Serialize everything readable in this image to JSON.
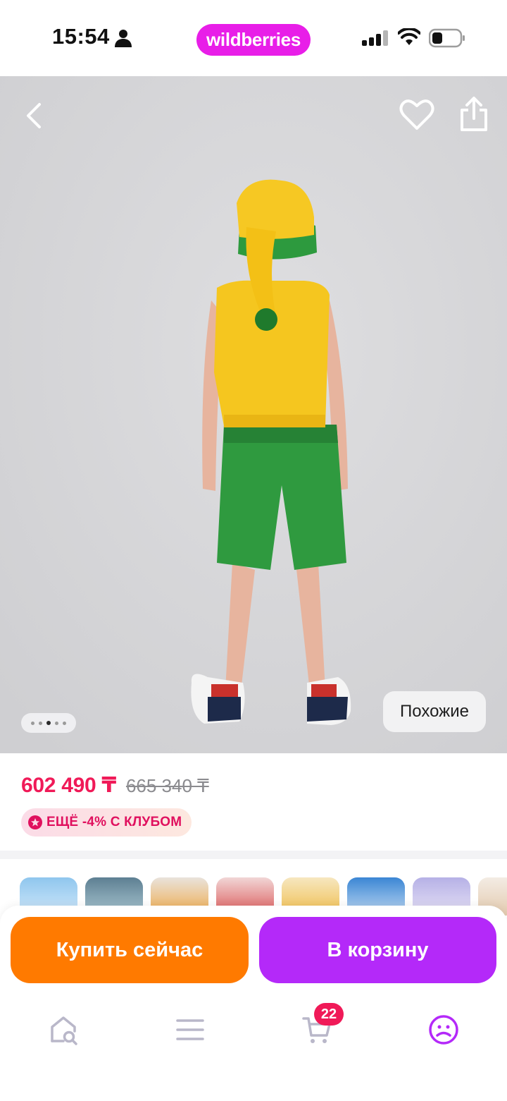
{
  "status_bar": {
    "time": "15:54",
    "brand": "wildberries",
    "icons": [
      "person-icon",
      "signal-icon",
      "wifi-icon",
      "battery-icon"
    ]
  },
  "hero": {
    "back_icon": "chevron-left-icon",
    "favorite_icon": "heart-outline-icon",
    "share_icon": "share-icon",
    "similar_label": "Похожие",
    "gallery": {
      "total": 5,
      "active_index": 2
    }
  },
  "price": {
    "current": "602 490 ₸",
    "old": "665 340 ₸",
    "club_badge": "ЕЩЁ -4% С КЛУБОМ",
    "club_icon": "club-star-icon"
  },
  "actions": {
    "buy_now": "Купить сейчас",
    "to_cart": "В корзину"
  },
  "tab_bar": {
    "items": [
      {
        "name": "home-search",
        "icon": "home-search-icon"
      },
      {
        "name": "catalog",
        "icon": "menu-icon"
      },
      {
        "name": "cart",
        "icon": "cart-icon"
      },
      {
        "name": "profile",
        "icon": "profile-icon"
      }
    ],
    "cart_count": "22",
    "active": "profile"
  },
  "colors": {
    "brand": "#e81ee8",
    "price": "#f01a58",
    "buy_now": "#ff7a00",
    "to_cart": "#b429f9",
    "tab_active": "#b429f9",
    "tab_inactive": "#b9b7c9"
  }
}
